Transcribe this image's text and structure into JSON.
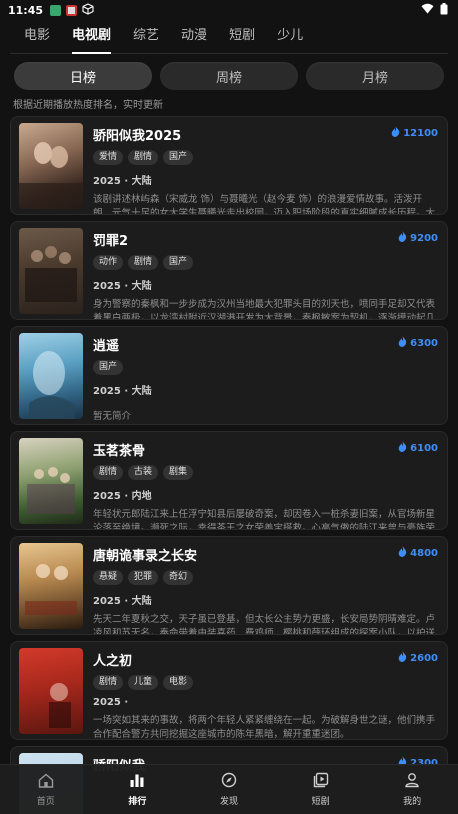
{
  "status": {
    "time": "11:45"
  },
  "top_tabs": [
    "电影",
    "电视剧",
    "综艺",
    "动漫",
    "短剧",
    "少儿"
  ],
  "rank_tabs": [
    "日榜",
    "周榜",
    "月榜"
  ],
  "hint": "根据近期播放热度排名，实时更新",
  "items": [
    {
      "title": "骄阳似我2025",
      "tags": [
        "爱情",
        "剧情",
        "国产"
      ],
      "meta": "2025 · 大陆",
      "heat": "12100",
      "desc": "该剧讲述林屿森（宋威龙 饰）与聂曦光（赵今麦 饰）的浪漫爱情故事。活泼开朗、元气十足的女大学生聂曦光走出校园，迈入职场阶段的真实细腻成长历程。大学时…"
    },
    {
      "title": "罚罪2",
      "tags": [
        "动作",
        "剧情",
        "国产"
      ],
      "meta": "2025 · 大陆",
      "heat": "9200",
      "desc": "身为警察的秦枫和一步步成为汉州当地最大犯罪头目的刘天也，喷同手足却又代表着黑白两极，以龙湾村附近汉湖港开发为大背景，秦枫敏案为契机，逐渐摸动起几方…"
    },
    {
      "title": "逍遥",
      "tags": [
        "国产"
      ],
      "meta": "2025 · 大陆",
      "heat": "6300",
      "desc": "暂无简介"
    },
    {
      "title": "玉茗茶骨",
      "tags": [
        "剧情",
        "古装",
        "剧集"
      ],
      "meta": "2025 · 内地",
      "heat": "6100",
      "desc": "年轻状元郎陆江来上任浮宁知县后屡破奇案，却因卷入一桩杀妻旧案，从官场新星沦落至绝境。濒死之际，幸得茶王之女荣善宝搭救。心高气傲的陆江来曾与豪族荣氏…"
    },
    {
      "title": "唐朝诡事录之长安",
      "tags": [
        "悬疑",
        "犯罪",
        "奇幻"
      ],
      "meta": "2025 · 大陆",
      "heat": "4800",
      "desc": "先天二年夏秋之交，天子虽已登基，但太长公主势力更盛，长安局势阴晴难定。卢凌风和苏无名，奉命带着由装喜药、费鸡师、樱桃和薛环组成的探案小队，以护送泰…"
    },
    {
      "title": "人之初",
      "tags": [
        "剧情",
        "儿童",
        "电影"
      ],
      "meta": "2025 ·",
      "heat": "2600",
      "desc": "一场突如其来的事故，将两个年轻人紧紧缠绕在一起。为破解身世之谜，他们携手合作配合警方共同挖掘这座城市的陈年黑暗，解开重重迷团。"
    },
    {
      "title": "骄阳似我",
      "tags": [],
      "meta": "",
      "heat": "2300",
      "desc": ""
    }
  ],
  "bottom_nav": [
    "首页",
    "排行",
    "发现",
    "短剧",
    "我的"
  ],
  "colors": {
    "accent": "#3f8ef7",
    "background": "#121212",
    "card": "#1c1c1c"
  }
}
